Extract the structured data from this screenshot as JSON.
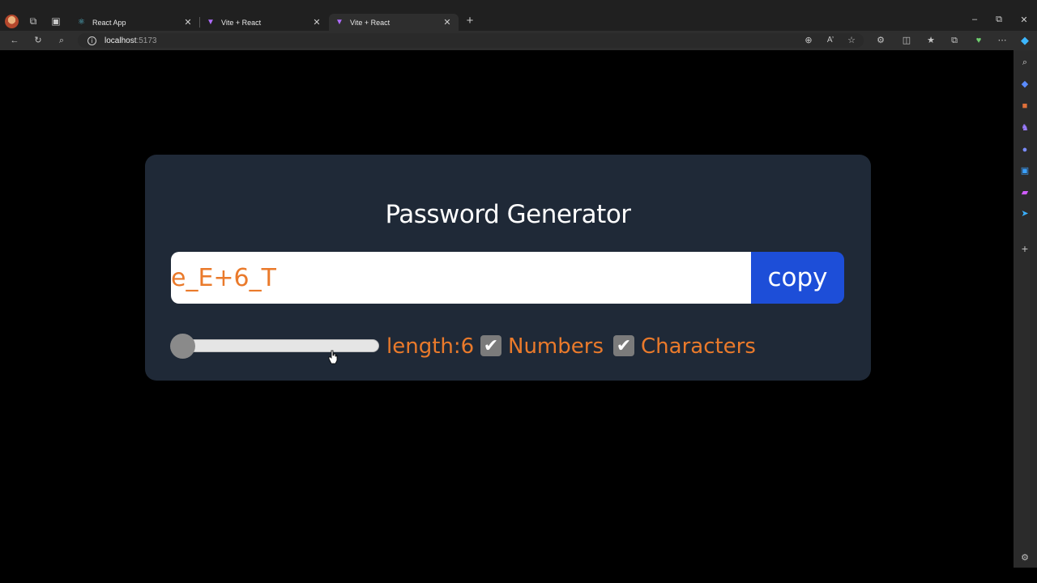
{
  "browser": {
    "tabs": [
      {
        "label": "React App",
        "favicon": "react-icon",
        "active": false
      },
      {
        "label": "Vite + React",
        "favicon": "vite-icon",
        "active": false
      },
      {
        "label": "Vite + React",
        "favicon": "vite-icon",
        "active": true
      }
    ],
    "url_host": "localhost",
    "url_port": ":5173"
  },
  "app": {
    "title": "Password Generator",
    "password": "e_E+6_T",
    "copy_label": "copy",
    "length_label": "length:6",
    "length_value": 6,
    "length_slider_fraction": 0,
    "numbers_label": "Numbers",
    "numbers_checked": true,
    "characters_label": "Characters",
    "characters_checked": true
  },
  "colors": {
    "card_bg": "#1f2937",
    "accent_orange": "#ea7a2b",
    "copy_button": "#1d4ed8"
  }
}
